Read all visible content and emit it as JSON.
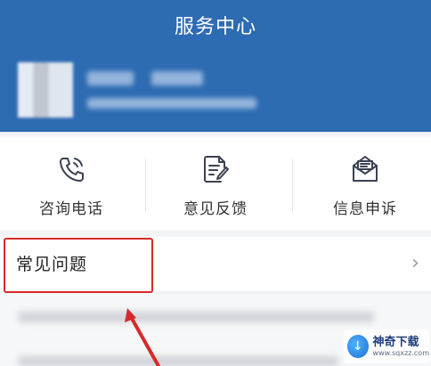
{
  "header": {
    "title": "服务中心"
  },
  "services": [
    {
      "label": "咨询电话",
      "icon": "phone-icon"
    },
    {
      "label": "意见反馈",
      "icon": "feedback-icon"
    },
    {
      "label": "信息申诉",
      "icon": "appeal-envelope-icon"
    }
  ],
  "faq": {
    "title": "常见问题",
    "chevron": "›"
  },
  "watermark": {
    "name": "神奇下载",
    "url": "www.sqxzz.com"
  },
  "colors": {
    "header_bg": "#2d6bb2",
    "highlight_red": "#d62a2a",
    "icon_stroke": "#3b4252"
  }
}
